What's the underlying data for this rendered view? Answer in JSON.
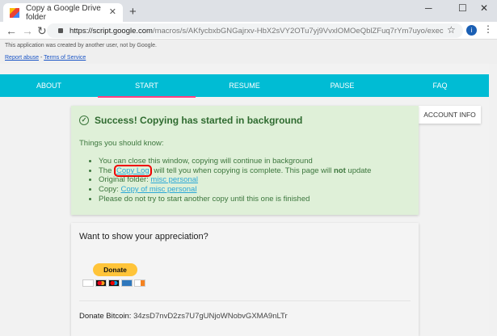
{
  "browser": {
    "tab_title": "Copy a Google Drive folder",
    "url_host": "https://script.google.com",
    "url_path": "/macros/s/AKfycbxbGNGajrxv-HbX2sVY2OTu7yj9VvxlOMOeQblZFuq7rYm7uyo/exec",
    "avatar_letter": "i"
  },
  "infobar": {
    "notice": "This application was created by another user, not by Google.",
    "report_abuse": "Report abuse",
    "separator": " - ",
    "terms": "Terms of Service"
  },
  "nav": {
    "items": [
      "ABOUT",
      "START",
      "RESUME",
      "PAUSE",
      "FAQ"
    ],
    "active": "START"
  },
  "account_info": "ACCOUNT INFO",
  "success": {
    "title": "Success! Copying has started in background",
    "intro": "Things you should know:",
    "item1": "You can close this window, copying will continue in background",
    "item2_pre": "The ",
    "item2_link": "Copy Log",
    "item2_mid": " will tell you when copying is complete. This page will ",
    "item2_bold": "not",
    "item2_post": " update",
    "item3_pre": "Original folder: ",
    "item3_link": "misc personal",
    "item4_pre": "Copy: ",
    "item4_link": "Copy of misc personal",
    "item5": "Please do not try to start another copy until this one is finished"
  },
  "appreciation": {
    "title": "Want to show your appreciation?",
    "donate_label": "Donate",
    "bitcoin_label": "Donate Bitcoin:",
    "bitcoin_address": "34zsD7nvD2zs7U7gUNjoWNobvGXMA9nLTr"
  },
  "colors": {
    "accent": "#00bcd4",
    "active_underline": "#ff4081",
    "success_bg": "#dff0d8",
    "success_text": "#3c763d"
  }
}
